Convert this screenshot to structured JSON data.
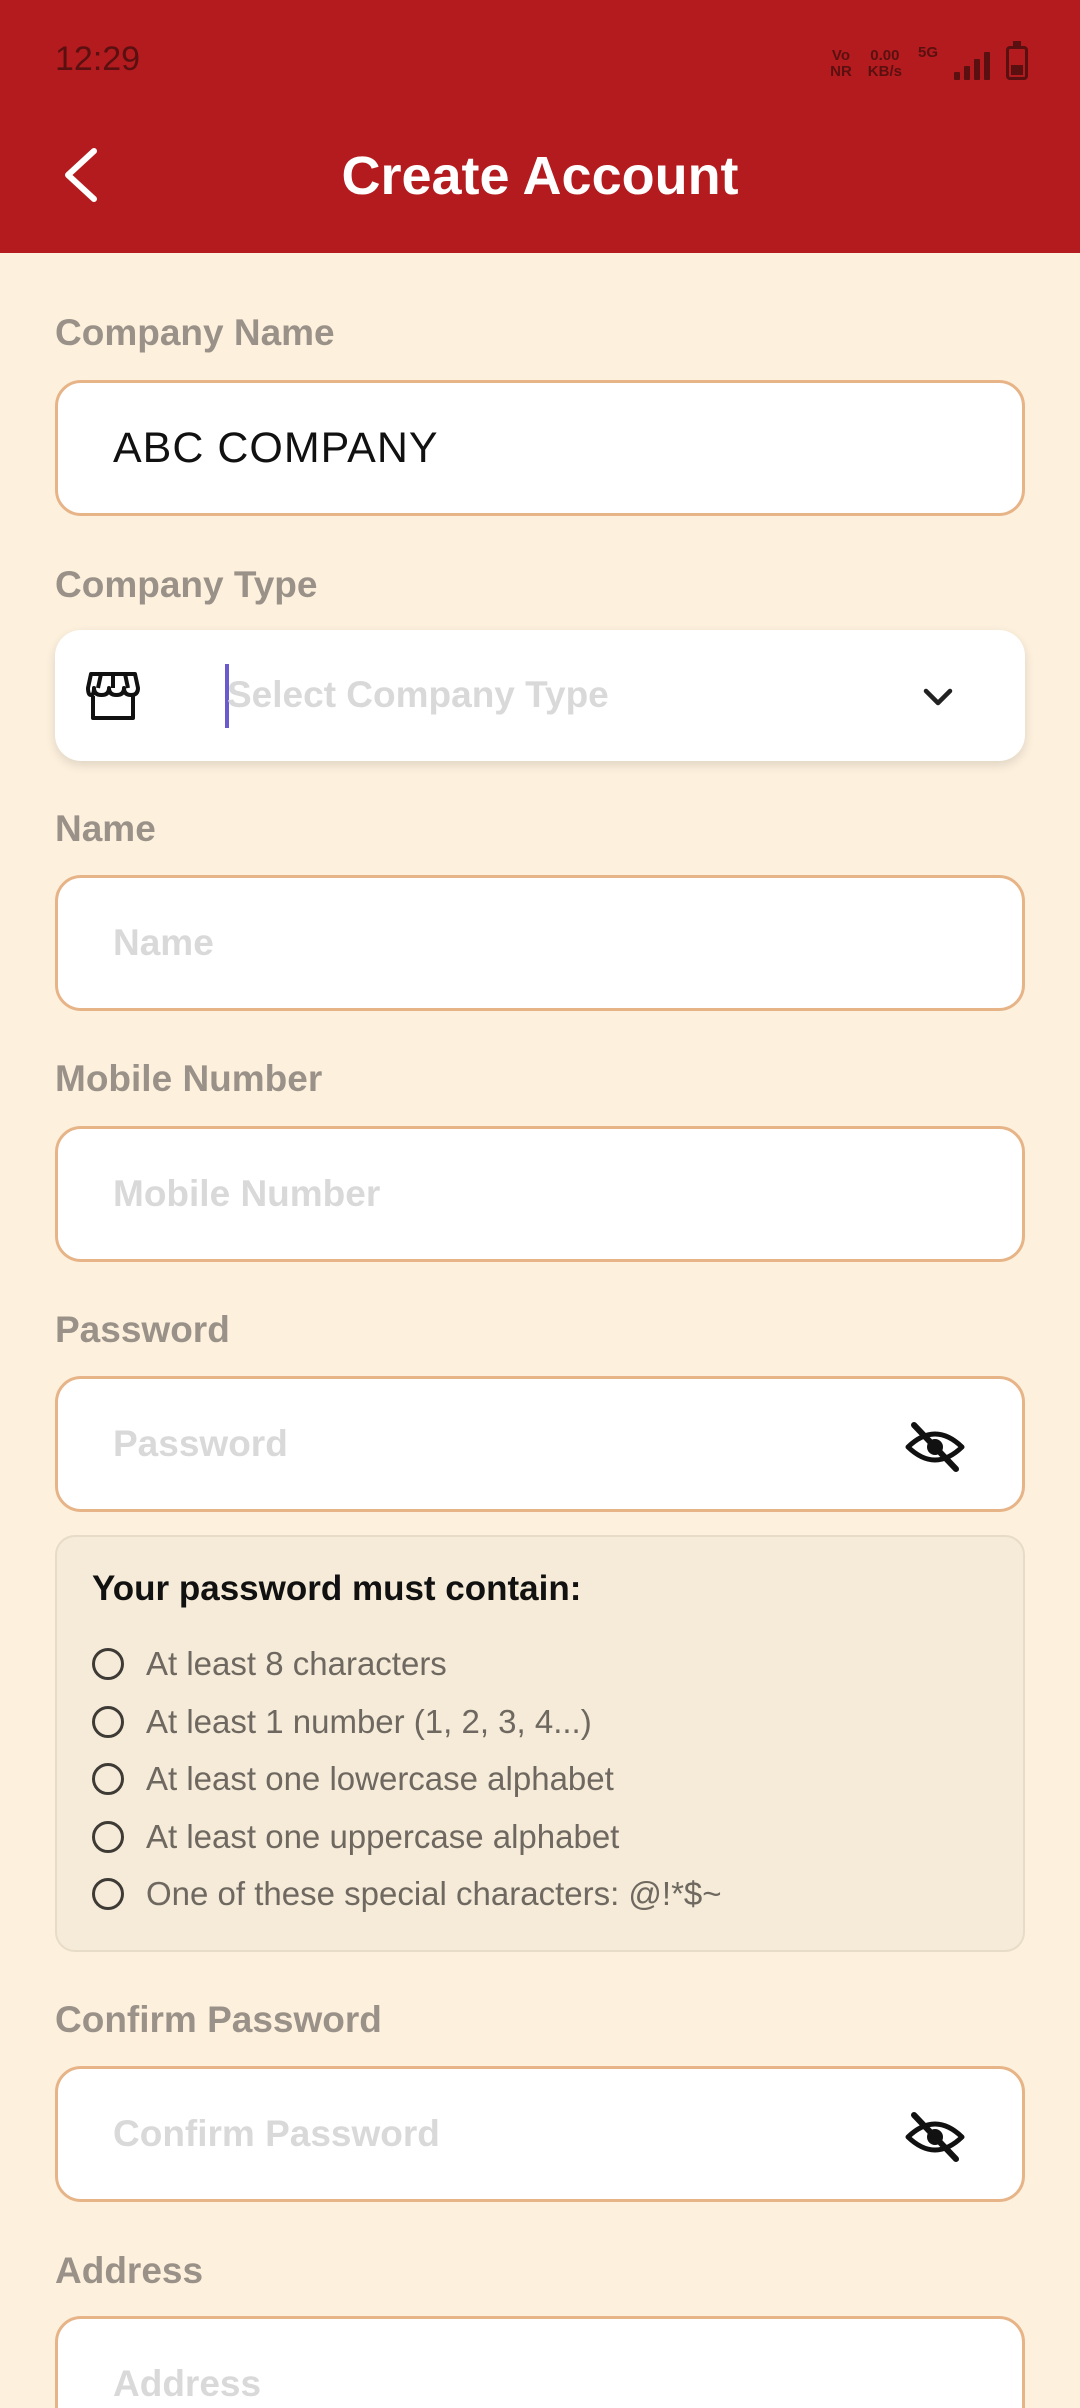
{
  "status_bar": {
    "time": "12:29",
    "vonr_top": "Vo",
    "vonr_bottom": "NR",
    "speed_value": "0.00",
    "speed_unit": "KB/s",
    "network": "5G"
  },
  "header": {
    "title": "Create Account",
    "back_icon": "chevron-left-icon",
    "background_color": "#B31B1E"
  },
  "form": {
    "company_name": {
      "label": "Company Name",
      "value": "ABC COMPANY"
    },
    "company_type": {
      "label": "Company Type",
      "placeholder": "Select Company Type",
      "icon": "store-icon"
    },
    "name": {
      "label": "Name",
      "placeholder": "Name",
      "value": ""
    },
    "mobile": {
      "label": "Mobile Number",
      "placeholder": "Mobile Number",
      "value": ""
    },
    "password": {
      "label": "Password",
      "placeholder": "Password",
      "value": "",
      "toggle_icon": "eye-off-icon"
    },
    "password_rules": {
      "title": "Your password must contain:",
      "items": [
        "At least 8 characters",
        "At least 1 number (1, 2, 3, 4...)",
        "At least one lowercase alphabet",
        "At least one uppercase alphabet",
        "One of these special characters: @!*$~"
      ]
    },
    "confirm_password": {
      "label": "Confirm Password",
      "placeholder": "Confirm Password",
      "value": "",
      "toggle_icon": "eye-off-icon"
    },
    "address": {
      "label": "Address",
      "placeholder": "Address",
      "value": ""
    }
  },
  "colors": {
    "page_background": "#FDF0DD",
    "field_border": "#E7B488",
    "label": "#9A9289",
    "placeholder": "#D9D9D9"
  }
}
